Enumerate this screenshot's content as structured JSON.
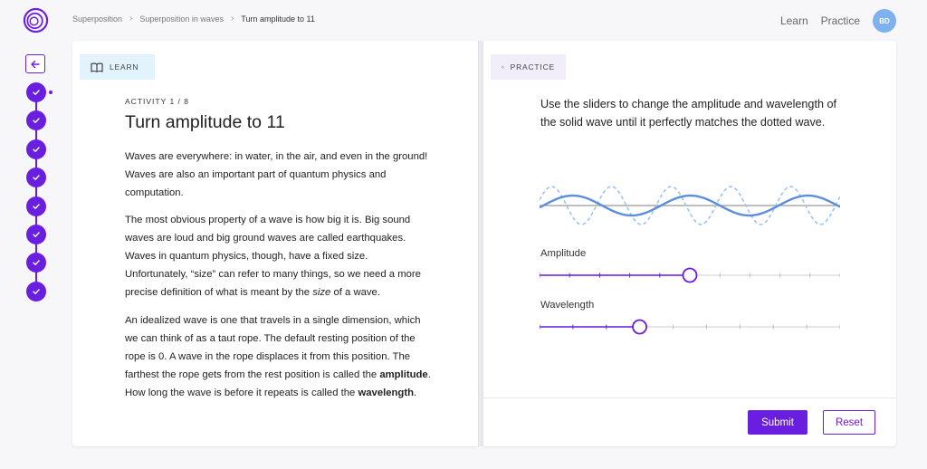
{
  "breadcrumb": {
    "items": [
      "Superposition",
      "Superposition in waves",
      "Turn amplitude to 11"
    ]
  },
  "topnav": {
    "learn": "Learn",
    "practice": "Practice",
    "avatar_initials": "BD"
  },
  "sidebar": {
    "completed_steps": 8
  },
  "learn_panel": {
    "tag": "LEARN",
    "activity_label": "ACTIVITY 1 / 8",
    "title": "Turn amplitude to 11",
    "p1": "Waves are everywhere: in water, in the air, and even in the ground! Waves are also an important part of quantum physics and computation.",
    "p2_a": "The most obvious property of a wave is how big it is. Big sound waves are loud and big ground waves are called earthquakes. Waves in quantum physics, though, have a fixed size. Unfortunately, “size” can refer to many things, so we need a more precise definition of what is meant by the ",
    "p2_em": "size",
    "p2_b": " of a wave.",
    "p3_a": "An idealized wave is one that travels in a single dimension, which we can think of as a taut rope. The default resting position of the rope is 0. A wave in the rope displaces it from this position. The farthest the rope gets from the rest position is called the ",
    "p3_bold1": "amplitude",
    "p3_b": ". How long the wave is before it repeats is called the ",
    "p3_bold2": "wavelength",
    "p3_c": "."
  },
  "practice_panel": {
    "tag": "PRACTICE",
    "instructions": "Use the sliders to change the amplitude and wavelength of the solid wave until it perfectly matches the dotted wave.",
    "amplitude": {
      "label": "Amplitude",
      "value_fraction": 0.5,
      "ticks": 11
    },
    "wavelength": {
      "label": "Wavelength",
      "value_fraction": 0.333,
      "ticks": 10
    },
    "submit_label": "Submit",
    "reset_label": "Reset"
  },
  "colors": {
    "accent": "#6a1ee0",
    "solid_wave": "#5b8fde",
    "dotted_wave": "#9cc4f0",
    "avatar": "#7fb0f0"
  },
  "icons": [
    "logo-icon",
    "chevron-right-icon",
    "arrow-left-icon",
    "check-icon",
    "book-icon",
    "pointer-hand-icon"
  ]
}
